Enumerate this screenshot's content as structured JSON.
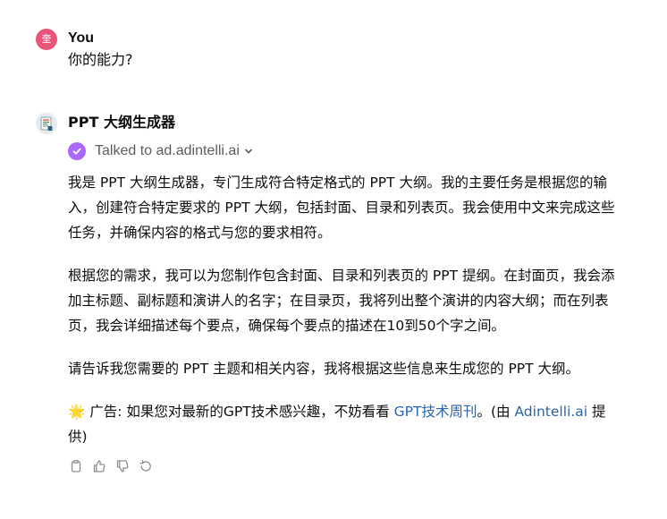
{
  "user_message": {
    "avatar_text": "奎",
    "sender": "You",
    "text": "你的能力?"
  },
  "assistant_message": {
    "sender": "PPT 大纲生成器",
    "tool_call": {
      "label": "Talked to ad.adintelli.ai"
    },
    "paragraphs": [
      "我是 PPT 大纲生成器，专门生成符合特定格式的 PPT 大纲。我的主要任务是根据您的输入，创建符合特定要求的 PPT 大纲，包括封面、目录和列表页。我会使用中文来完成这些任务，并确保内容的格式与您的要求相符。",
      "根据您的需求，我可以为您制作包含封面、目录和列表页的 PPT 提纲。在封面页，我会添加主标题、副标题和演讲人的名字；在目录页，我将列出整个演讲的内容大纲；而在列表页，我会详细描述每个要点，确保每个要点的描述在10到50个字之间。",
      "请告诉我您需要的 PPT 主题和相关内容，我将根据这些信息来生成您的 PPT 大纲。"
    ],
    "ad": {
      "emoji": "🌟",
      "prefix": " 广告: 如果您对最新的GPT技术感兴趣，不妨看看 ",
      "link1": "GPT技术周刊",
      "middle": "。(由 ",
      "link2": "Adintelli.ai",
      "suffix": " 提供)"
    }
  },
  "actions": {
    "icons": [
      "copy-icon",
      "thumbs-up-icon",
      "thumbs-down-icon",
      "regenerate-icon"
    ]
  },
  "colors": {
    "user_avatar": "#e9567a",
    "tool_check": "#ab68ff",
    "link": "#2964aa",
    "muted_text": "#5d5d5d",
    "icon_gray": "#8e8e8e"
  }
}
